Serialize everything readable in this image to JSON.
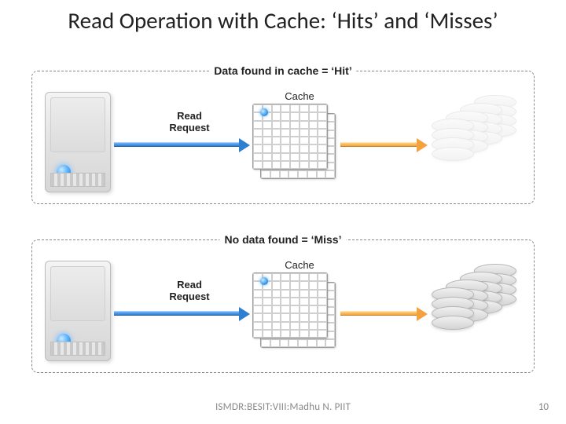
{
  "title": "Read Operation with Cache: ‘Hits’ and ‘Misses’",
  "panel_hit": {
    "label": "Data found in cache = ‘Hit’",
    "read_request": "Read Request",
    "cache_label": "Cache"
  },
  "panel_miss": {
    "label": "No data found = ‘Miss’",
    "read_request": "Read Request",
    "cache_label": "Cache"
  },
  "footer": "ISMDR:BESIT:VIII:Madhu N. PIIT",
  "page_number": "10",
  "colors": {
    "dashed_border": "#888",
    "arrow_blue": "#2f7fd1",
    "arrow_orange": "#f3a23d"
  }
}
